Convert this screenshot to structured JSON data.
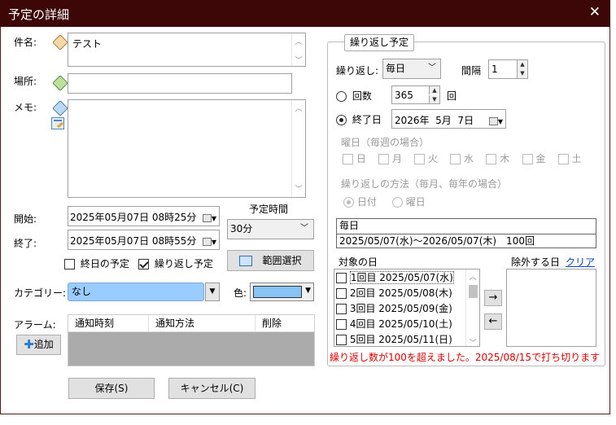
{
  "window": {
    "title": "予定の詳細"
  },
  "left": {
    "subject_label": "件名:",
    "subject_value": "テスト",
    "place_label": "場所:",
    "place_value": "",
    "memo_label": "メモ:",
    "memo_value": "",
    "start_label": "開始:",
    "start_value": "2025年05月07日 08時25分",
    "end_label": "終了:",
    "end_value": "2025年05月07日 08時55分",
    "duration_label": "予定時間",
    "duration_value": "30分",
    "allday_label": "終日の予定",
    "allday_checked": false,
    "repeat_label": "繰り返し予定",
    "repeat_checked": true,
    "range_button": "範囲選択",
    "category_label": "カテゴリー:",
    "category_value": "なし",
    "category_color": "#99ccff",
    "color_label": "色:",
    "color_swatch": "#88c4f5",
    "alarm_label": "アラーム:",
    "alarm_add_button": "追加",
    "alarm_columns": [
      "通知時刻",
      "通知方法",
      "削除"
    ]
  },
  "footer": {
    "save_button": "保存(S)",
    "cancel_button": "キャンセル(C)"
  },
  "repeat": {
    "group_title": "繰り返し予定",
    "repeat_label": "繰り返し:",
    "repeat_value": "毎日",
    "interval_label": "間隔",
    "interval_value": "1",
    "count_label": "回数",
    "count_value": "365",
    "count_unit": "回",
    "count_selected": false,
    "enddate_label": "終了日",
    "enddate_value": "2026年  5月  7日",
    "enddate_selected": true,
    "weekday_section": "曜日（毎週の場合）",
    "weekdays": [
      "日",
      "月",
      "火",
      "水",
      "木",
      "金",
      "土"
    ],
    "method_section": "繰り返しの方法（毎月、毎年の場合）",
    "method_options": [
      "日付",
      "曜日"
    ],
    "summary_line1": "毎日",
    "summary_line2": "2025/05/07(水)〜2026/05/07(木)　100回",
    "target_days_label": "対象の日",
    "target_days": [
      "1回目 2025/05/07(水)",
      "2回目 2025/05/08(木)",
      "3回目 2025/05/09(金)",
      "4回目 2025/05/10(土)",
      "5回目 2025/05/11(日)"
    ],
    "exclude_label": "除外する日",
    "clear_link": "クリア",
    "move_right": "→",
    "move_left": "←",
    "warning": "繰り返し数が100を超えました。2025/08/15で打ち切ります",
    "warning_color": "#e00000"
  },
  "icons": {
    "close": "close-icon",
    "tag": "tag-icon",
    "calendar": "calendar-icon",
    "plus": "plus-icon",
    "memo_edit": "memo-edit-icon"
  }
}
